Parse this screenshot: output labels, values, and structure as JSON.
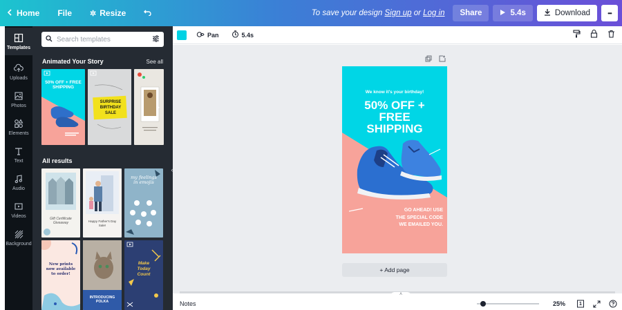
{
  "topbar": {
    "home_label": "Home",
    "file_label": "File",
    "resize_label": "Resize",
    "save_hint_prefix": "To save your design",
    "sign_up": "Sign up",
    "or": "or",
    "log_in": "Log in",
    "share_label": "Share",
    "play_label": "5.4s",
    "download_label": "Download",
    "more_label": "•••"
  },
  "rail": {
    "items": [
      {
        "label": "Templates",
        "icon": "templates-icon"
      },
      {
        "label": "Uploads",
        "icon": "upload-icon"
      },
      {
        "label": "Photos",
        "icon": "photo-icon"
      },
      {
        "label": "Elements",
        "icon": "elements-icon"
      },
      {
        "label": "Text",
        "icon": "text-icon"
      },
      {
        "label": "Audio",
        "icon": "music-icon"
      },
      {
        "label": "Videos",
        "icon": "video-icon"
      },
      {
        "label": "Background",
        "icon": "background-icon"
      }
    ]
  },
  "panel": {
    "search_placeholder": "Search templates",
    "section1_title": "Animated Your Story",
    "see_all": "See all",
    "section2_title": "All results",
    "t1_text": "50% OFF + FREE SHIPPING",
    "t2_text": "SURPRISE BIRTHDAY SALE",
    "t4_text": "Gift Certificate Giveaway",
    "t5_text": "Happy Father's Day Sale!",
    "t6_text": "my feelings in emojis",
    "t7_text": "New prints now available to order!",
    "t8_text": "INTRODUCING POLKA",
    "t9_text": "Make Today Count"
  },
  "editor_toolbar": {
    "swatch_color": "#00d2e4",
    "pan_label": "Pan",
    "duration_label": "5.4s"
  },
  "design": {
    "top_line": "We know it's your birthday!",
    "headline_1": "50% OFF +",
    "headline_2": "FREE",
    "headline_3": "SHIPPING",
    "bottom_1": "GO AHEAD! USE",
    "bottom_2": "THE SPECIAL CODE",
    "bottom_3": "WE EMAILED YOU."
  },
  "canvas": {
    "add_page_label": "+ Add page"
  },
  "bottombar": {
    "notes_label": "Notes",
    "zoom_label": "25%",
    "zoom_fraction": 0.1,
    "page_count": "1"
  },
  "colors": {
    "cyan": "#00d6e6",
    "salmon": "#f7a39a",
    "panel_bg": "#252b33",
    "rail_bg": "#0e1318"
  }
}
